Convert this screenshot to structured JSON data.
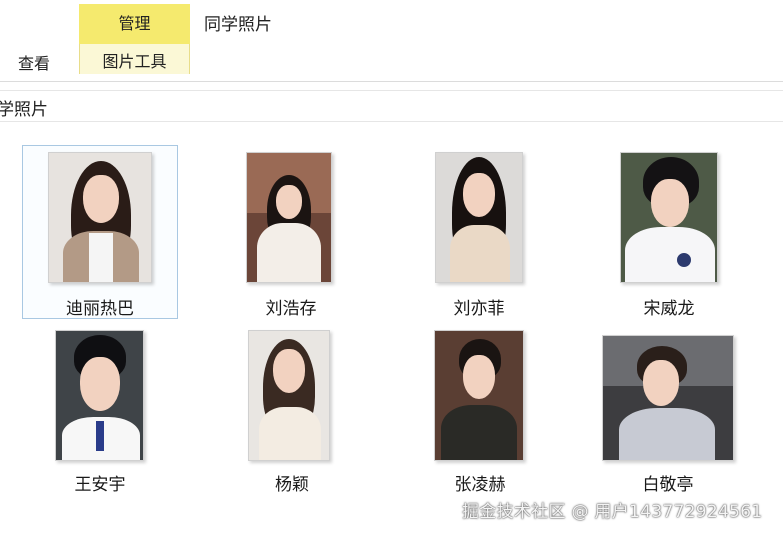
{
  "ribbon": {
    "manage_tab": "管理",
    "window_title": "同学照片",
    "view_tab": "查看",
    "picture_tools_tab": "图片工具"
  },
  "path_label": "学照片",
  "photos": [
    {
      "name": "迪丽热巴",
      "selected": true
    },
    {
      "name": "刘浩存"
    },
    {
      "name": "刘亦菲"
    },
    {
      "name": "宋威龙"
    },
    {
      "name": "王安宇"
    },
    {
      "name": "杨颖"
    },
    {
      "name": "张凌赫"
    },
    {
      "name": "白敬亭"
    }
  ],
  "watermark": "掘金技术社区 @ 用户143772924561",
  "colors": {
    "manage_tab_bg": "#f5ea6e",
    "selection_border": "#a9c8e2"
  }
}
